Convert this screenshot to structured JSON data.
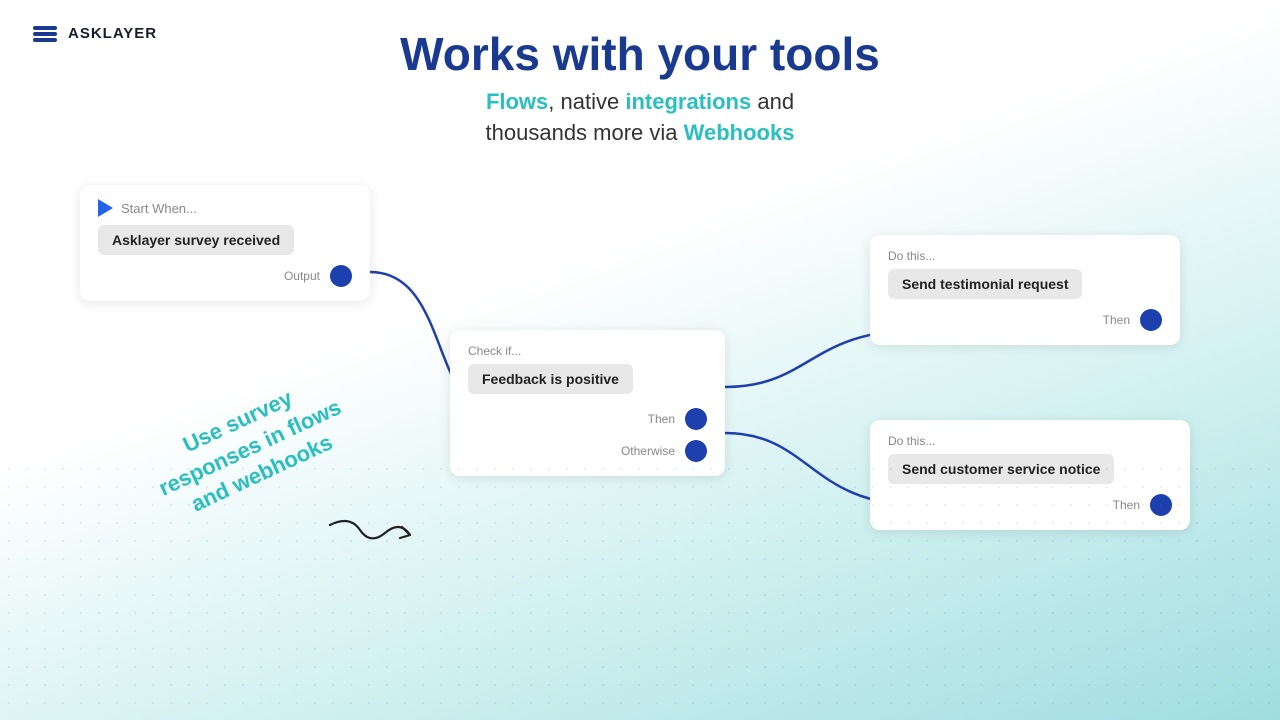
{
  "logo": {
    "text": "ASKLAYER"
  },
  "header": {
    "main_title": "Works with your tools",
    "subtitle_prefix": "",
    "subtitle_flows": "Flows",
    "subtitle_middle": ", native ",
    "subtitle_integrations": "integrations",
    "subtitle_and": " and",
    "subtitle_via": "thousands more via ",
    "subtitle_webhooks": "Webhooks"
  },
  "decorative": {
    "text": "Use survey responses in flows and webhooks"
  },
  "nodes": {
    "start": {
      "label": "Start When...",
      "content": "Asklayer survey received",
      "output_label": "Output"
    },
    "check": {
      "label": "Check if...",
      "content": "Feedback is positive",
      "then_label": "Then",
      "otherwise_label": "Otherwise"
    },
    "action_top": {
      "label": "Do this...",
      "content": "Send testimonial request",
      "then_label": "Then"
    },
    "action_bottom": {
      "label": "Do this...",
      "content": "Send customer service notice",
      "then_label": "Then"
    }
  },
  "colors": {
    "accent_blue": "#1e40af",
    "accent_teal": "#2abfbf",
    "title_blue": "#1a3a8f",
    "dot_blue": "#1e40af"
  }
}
